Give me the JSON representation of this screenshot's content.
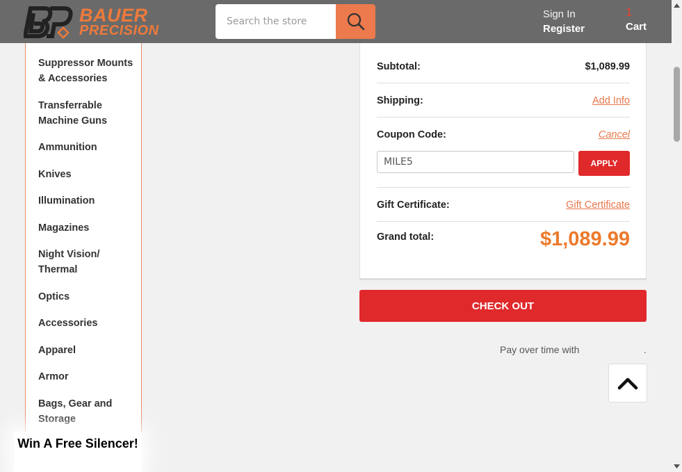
{
  "header": {
    "brand_line1": "BAUER",
    "brand_line2": "PRECISION",
    "search_placeholder": "Search the store",
    "sign_in": "Sign In",
    "register": "Register",
    "cart_count": "1",
    "cart_label": "Cart"
  },
  "sidebar": {
    "items": [
      "Suppressor Mounts & Accessories",
      "Transferrable Machine Guns",
      "Ammunition",
      "Knives",
      "Illumination",
      "Magazines",
      "Night Vision/ Thermal",
      "Optics",
      "Accessories",
      "Apparel",
      "Armor",
      "Bags, Gear and Storage"
    ]
  },
  "promo": {
    "text": "Win A Free Silencer!"
  },
  "summary": {
    "subtotal_label": "Subtotal:",
    "subtotal_value": "$1,089.99",
    "shipping_label": "Shipping:",
    "shipping_link": "Add Info",
    "coupon_label": "Coupon Code:",
    "coupon_cancel": "Cancel",
    "coupon_value": "MILE5",
    "apply_label": "APPLY",
    "gift_label": "Gift Certificate:",
    "gift_link": "Gift Certificate",
    "grand_label": "Grand total:",
    "grand_value": "$1,089.99"
  },
  "checkout": {
    "label": "CHECK OUT"
  },
  "payover": {
    "text": "Pay over time with",
    "dot": "."
  },
  "colors": {
    "accent_orange": "#ec7a3c",
    "button_red": "#e0292b",
    "header_gray": "#6a6a6a"
  },
  "icons": {
    "search": "search-icon",
    "back_to_top": "chevron-up-icon"
  }
}
